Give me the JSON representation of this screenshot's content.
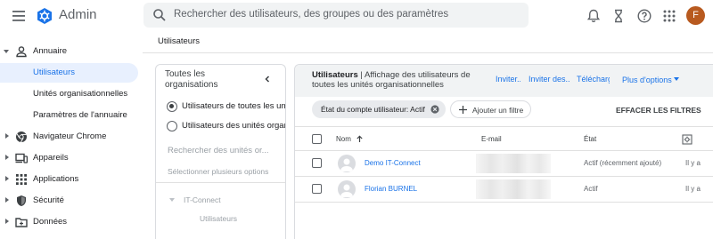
{
  "app": {
    "title": "Admin"
  },
  "search": {
    "placeholder": "Rechercher des utilisateurs, des groupes ou des paramètres"
  },
  "account": {
    "initial": "F"
  },
  "page": {
    "title": "Utilisateurs"
  },
  "sidebar": {
    "items": [
      {
        "label": "Annuaire",
        "icon": "person-icon",
        "expanded": true
      },
      {
        "label": "Utilisateurs",
        "active": true
      },
      {
        "label": "Unités organisationnelles"
      },
      {
        "label": "Paramètres de l'annuaire"
      },
      {
        "label": "Navigateur Chrome",
        "icon": "chrome-icon"
      },
      {
        "label": "Appareils",
        "icon": "devices-icon"
      },
      {
        "label": "Applications",
        "icon": "apps-grid-icon"
      },
      {
        "label": "Sécurité",
        "icon": "shield-icon"
      },
      {
        "label": "Données",
        "icon": "folder-icon"
      }
    ]
  },
  "org_panel": {
    "title": "Toutes les organisations",
    "options": [
      {
        "label": "Utilisateurs de toutes les unités organisationnelles",
        "selected": true
      },
      {
        "label": "Utilisateurs des unités organisationnelles sélectionnées",
        "selected": false
      }
    ],
    "search_placeholder": "Rechercher des unités or...",
    "multi_select": "Sélectionner plusieurs options",
    "tree": {
      "root": "IT-Connect",
      "child": "Utilisateurs"
    }
  },
  "main": {
    "title_bold": "Utilisateurs",
    "title_rest": " | Affichage des utilisateurs de toutes les unités organisationnelles",
    "actions": {
      "invite": "Inviter...",
      "invite_multiple": "Inviter des...",
      "download": "Télécharger...",
      "more": "Plus d'options"
    },
    "filter_chip": "État du compte utilisateur: Actif",
    "add_filter": "Ajouter un filtre",
    "clear_filters": "EFFACER LES FILTRES",
    "columns": {
      "name": "Nom",
      "email": "E-mail",
      "status": "État"
    },
    "rows": [
      {
        "name": "Demo IT-Connect",
        "status": "Actif (récemment ajouté)",
        "last_login": "Il y a"
      },
      {
        "name": "Florian BURNEL",
        "status": "Actif",
        "last_login": "Il y a"
      }
    ]
  },
  "colors": {
    "accent": "#1a73e8",
    "active_bg": "#e8f0fe",
    "avatar": "#b85a1f"
  }
}
